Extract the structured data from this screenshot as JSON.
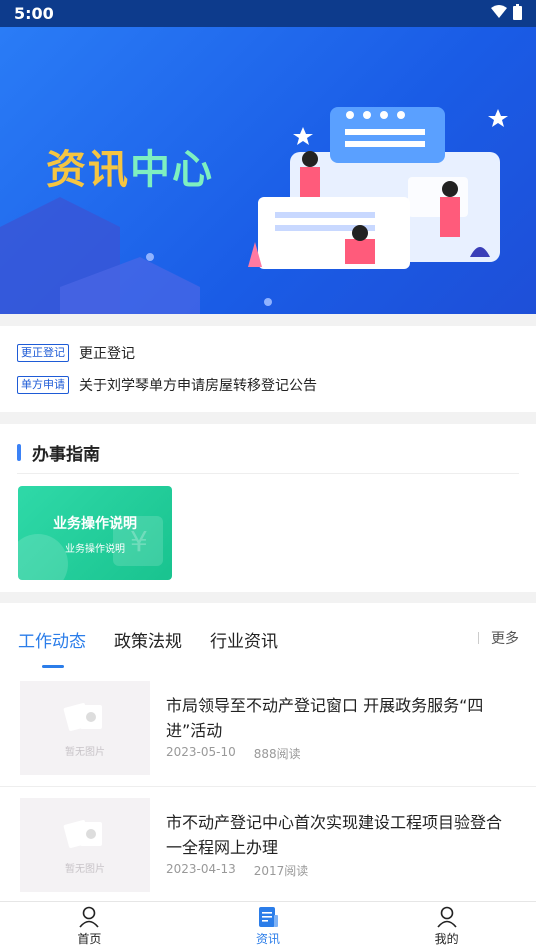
{
  "status_bar": {
    "time": "5:00"
  },
  "banner": {
    "title_part1": "资讯",
    "title_part2": "中心"
  },
  "notices": [
    {
      "tag": "更正登记",
      "text": "更正登记"
    },
    {
      "tag": "单方申请",
      "text": "关于刘学琴单方申请房屋转移登记公告"
    }
  ],
  "guide": {
    "heading": "办事指南",
    "card": {
      "title": "业务操作说明",
      "subtitle": "业务操作说明"
    }
  },
  "news": {
    "tabs": [
      {
        "label": "工作动态",
        "active": true
      },
      {
        "label": "政策法规",
        "active": false
      },
      {
        "label": "行业资讯",
        "active": false
      }
    ],
    "more_label": "更多",
    "placeholder_text": "暂无图片",
    "articles": [
      {
        "title": "市局领导至不动产登记窗口 开展政务服务“四进”活动",
        "date": "2023-05-10",
        "reads": "888阅读"
      },
      {
        "title": "市不动产登记中心首次实现建设工程项目验登合一全程网上办理",
        "date": "2023-04-13",
        "reads": "2017阅读"
      }
    ]
  },
  "bottom_nav": [
    {
      "label": "首页",
      "icon": "person-icon",
      "active": false
    },
    {
      "label": "资讯",
      "icon": "news-icon",
      "active": true
    },
    {
      "label": "我的",
      "icon": "person-icon",
      "active": false
    }
  ],
  "colors": {
    "accent": "#2b7de9",
    "status_bar": "#0d3b8c",
    "card": "#19c38f"
  }
}
